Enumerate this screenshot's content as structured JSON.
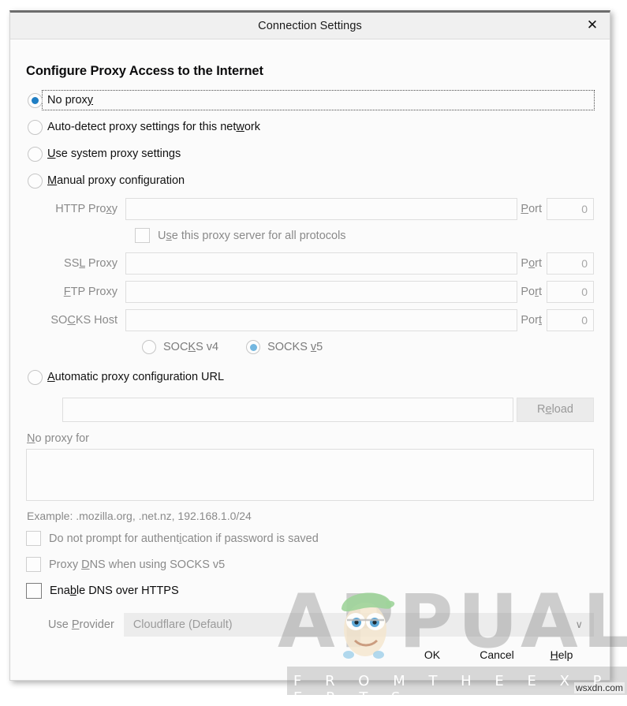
{
  "window": {
    "title": "Connection Settings",
    "close_icon": "close-icon",
    "close_glyph": "✕"
  },
  "main": {
    "section_title": "Configure Proxy Access to the Internet",
    "proxy_mode_options": [
      {
        "label": "No proxy",
        "accesskey": "x",
        "selected": true,
        "focused": true
      },
      {
        "label": "Auto-detect proxy settings for this network",
        "accesskey": "w",
        "selected": false,
        "focused": false
      },
      {
        "label": "Use system proxy settings",
        "accesskey": "U",
        "selected": false,
        "focused": false
      },
      {
        "label": "Manual proxy configuration",
        "accesskey": "M",
        "selected": false,
        "focused": false
      },
      {
        "label": "Automatic proxy configuration URL",
        "accesskey": "A",
        "selected": false,
        "focused": false
      }
    ],
    "manual_fields": [
      {
        "label": "HTTP Proxy",
        "value": "",
        "port_label": "Port",
        "port_value": "0"
      },
      {
        "label": "SSL Proxy",
        "value": "",
        "port_label": "Port",
        "port_value": "0"
      },
      {
        "label": "FTP Proxy",
        "value": "",
        "port_label": "Port",
        "port_value": "0"
      },
      {
        "label": "SOCKS Host",
        "value": "",
        "port_label": "Port",
        "port_value": "0"
      }
    ],
    "use_for_all_protocols": {
      "label": "Use this proxy server for all protocols",
      "checked": false,
      "enabled": false
    },
    "socks_version": {
      "v4_label": "SOCKS v4",
      "v5_label": "SOCKS v5",
      "selected": "v5"
    },
    "pac": {
      "url_value": "",
      "reload_label": "Reload"
    },
    "no_proxy_for": {
      "label": "No proxy for",
      "value": "",
      "example": "Example: .mozilla.org, .net.nz, 192.168.1.0/24"
    },
    "checkboxes": [
      {
        "label": "Do not prompt for authentication if password is saved",
        "checked": false,
        "enabled": false
      },
      {
        "label": "Proxy DNS when using SOCKS v5",
        "checked": false,
        "enabled": false
      },
      {
        "label": "Enable DNS over HTTPS",
        "checked": false,
        "enabled": true
      }
    ],
    "provider": {
      "label": "Use Provider",
      "value": "Cloudflare (Default)",
      "chevron": "∨"
    }
  },
  "footer": {
    "buttons": [
      {
        "label": "OK"
      },
      {
        "label": "Cancel"
      },
      {
        "label": "Help"
      }
    ]
  },
  "watermark": {
    "brand": "APPUALS",
    "tagline": "F R O M   T H E   E X P E R T S",
    "site": "wsxdn.com"
  },
  "colors": {
    "accent_blue": "#1f7ec4",
    "accent_blue_disabled": "#73b7e0",
    "dialog_bg": "#fbfbfb",
    "titlebar_bg": "#f0f0f0",
    "disabled_text": "#8a8a8a",
    "enabled_text": "#0c0c0d"
  }
}
